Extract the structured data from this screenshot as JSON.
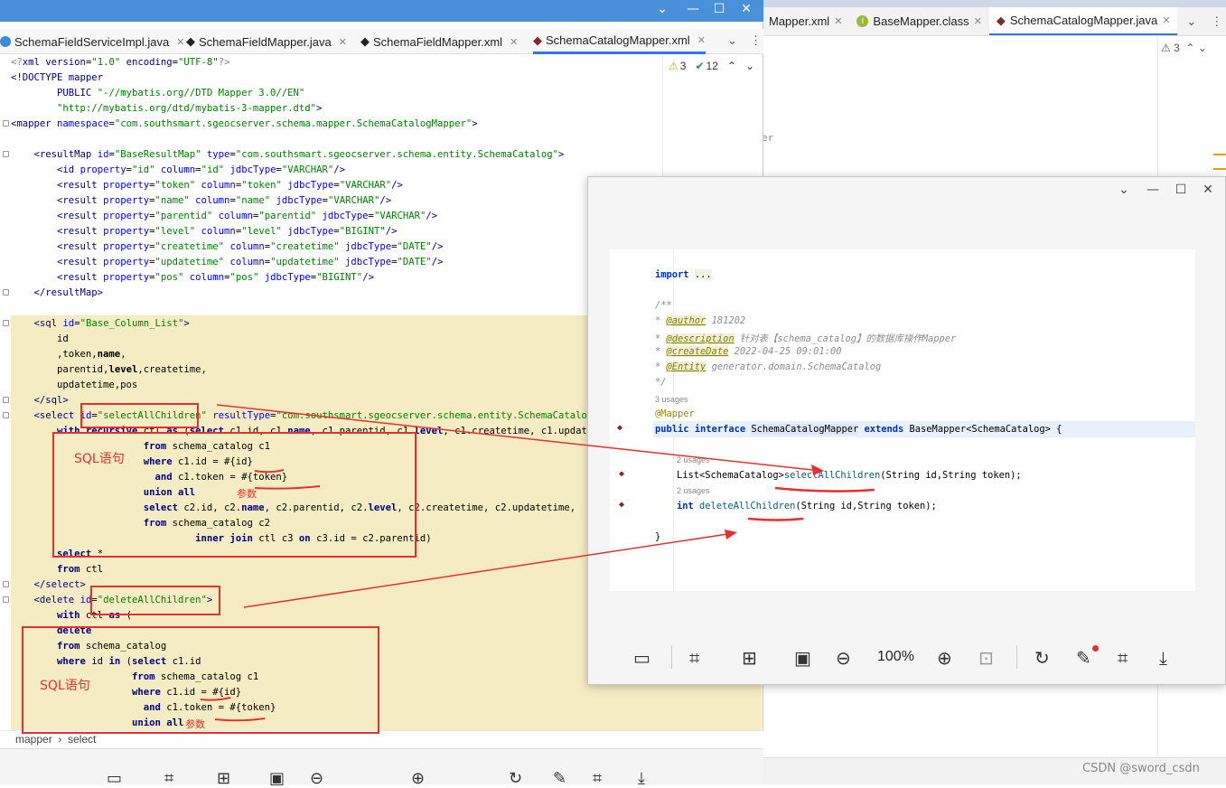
{
  "background_ide": {
    "tabs": [
      {
        "label": "Mapper.xml",
        "active": false
      },
      {
        "label": "BaseMapper.class",
        "active": false
      },
      {
        "label": "SchemaCatalogMapper.java",
        "active": true
      }
    ],
    "warnings": "3",
    "partial_text": "er"
  },
  "left_window": {
    "tabs": [
      {
        "label": "SchemaFieldServiceImpl.java"
      },
      {
        "label": "SchemaFieldMapper.java"
      },
      {
        "label": "SchemaFieldMapper.xml"
      },
      {
        "label": "SchemaCatalogMapper.xml"
      }
    ],
    "warnings_count": "3",
    "checks_count": "12",
    "breadcrumb": [
      "mapper",
      "select"
    ],
    "annotations": {
      "sql_label_1": "SQL语句",
      "param_label_1": "参数",
      "sql_label_2": "SQL语句",
      "param_label_2": "参数"
    }
  },
  "right_window": {
    "usages_3": "3 usages",
    "usages_2a": "2 usages",
    "usages_2b": "2 usages",
    "zoom": "100%"
  },
  "watermark": "CSDN @sword_csdn"
}
